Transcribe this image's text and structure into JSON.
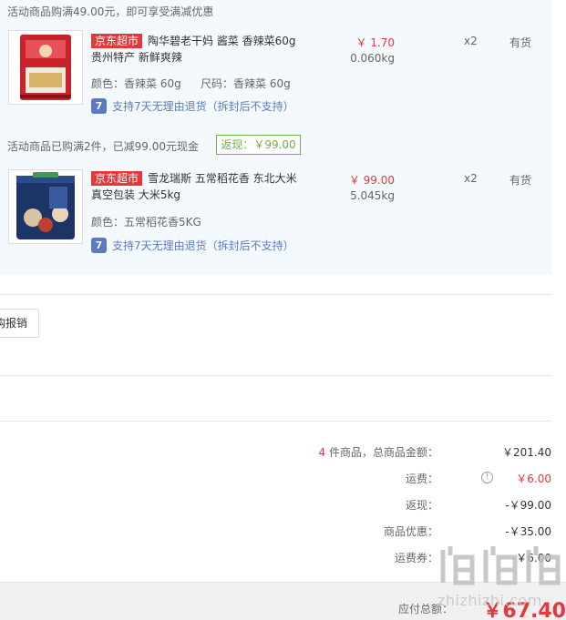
{
  "cart": {
    "promo_text_1": "活动商品购满49.00元，即可享受满减优惠",
    "promo_text_2": "活动商品已购满2件，已减99.00元现金",
    "rebate_badge": "返现：￥99.00",
    "items": [
      {
        "tag": "京东超市",
        "title": "陶华碧老干妈 酱菜 香辣菜60g 贵州特产 新鲜爽辣",
        "attr_color": "颜色：香辣菜 60g",
        "attr_size": "尺码：香辣菜 60g",
        "service": "支持7天无理由退货（拆封后不支持）",
        "price": "￥ 1.70",
        "weight": "0.060kg",
        "quantity": "x2",
        "stock": "有货"
      },
      {
        "tag": "京东超市",
        "title": "雪龙瑞斯 五常稻花香 东北大米 真空包装 大米5kg",
        "attr_color": "颜色：五常稻花香5KG",
        "service": "支持7天无理由退货（拆封后不支持）",
        "price": "￥ 99.00",
        "weight": "5.045kg",
        "quantity": "x2",
        "stock": "有货"
      }
    ],
    "service_icon_glyph": "7"
  },
  "reimburse_button": "购报销",
  "summary": {
    "count_number": "4",
    "count_label": " 件商品，总商品金额：",
    "total_value": "￥201.40",
    "shipping_label": "运费：",
    "shipping_value": "￥6.00",
    "rebate_label": "返现：",
    "rebate_value": "-￥99.00",
    "discount_label": "商品优惠：",
    "discount_value": "-￥35.00",
    "coupon_label": "运费券：",
    "coupon_value": "-￥6.00",
    "payable_label": "应付总额：",
    "payable_value": "￥67.40"
  },
  "watermark": {
    "text": "zhizhizhi.com"
  },
  "colors": {
    "accent_red": "#e4393c",
    "rebate_green": "#71b247",
    "service_blue": "#5b7bc0",
    "panel_bg": "#f3f9fd"
  },
  "icons": {
    "service_icon": "return-policy-icon",
    "info_icon": "info-circle-icon"
  }
}
